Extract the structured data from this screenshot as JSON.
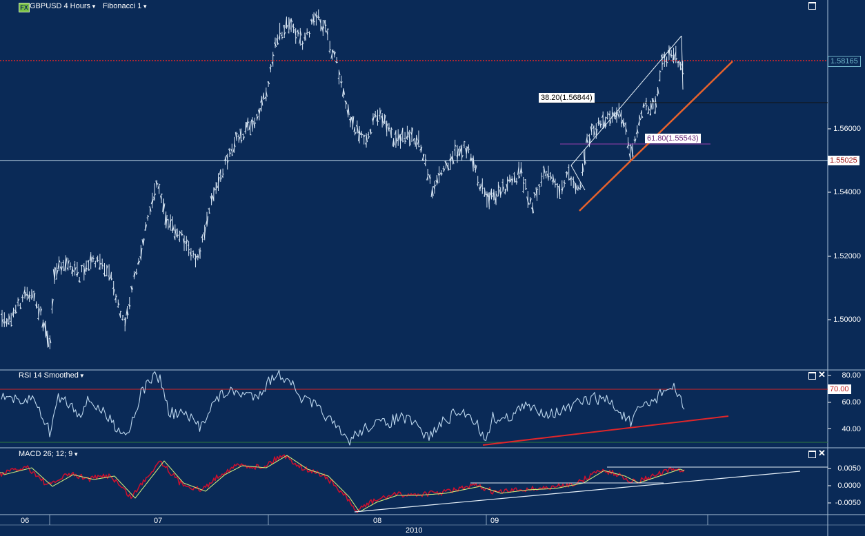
{
  "main_panel": {
    "symbol_badge": "FX",
    "symbol_label": "GBPUSD 4 Hours",
    "study_label": "Fibonacci 1",
    "y_ticks": [
      "1.56000",
      "1.54000",
      "1.52000",
      "1.50000"
    ],
    "last_price": "1.58165",
    "line_price": "1.55025",
    "fib_38": "38.20(1.56844)",
    "fib_61": "61.80(1.55543)"
  },
  "rsi_panel": {
    "label": "RSI 14 Smoothed",
    "y_ticks": [
      "80.00",
      "60.00",
      "40.00"
    ],
    "level_tag": "70.00"
  },
  "macd_panel": {
    "label": "MACD 26; 12; 9",
    "y_ticks": [
      "0.0050",
      "0.0000",
      "-0.0050"
    ]
  },
  "time_axis": {
    "month_labels": [
      "06",
      "07",
      "08",
      "09"
    ],
    "year_label": "2010"
  },
  "colors": {
    "background": "#0a2a57",
    "price_bars": "#d8e6f4",
    "trend_line": "#e8622c",
    "resistance_line": "#e0262a",
    "rsi_level_line": "#d42424",
    "macd_line": "#c8102e",
    "signal_line": "#c8e87c",
    "fib_61_line": "#9b3fae"
  },
  "icons": [
    "maximize-icon",
    "close-icon",
    "dropdown-caret-icon"
  ]
}
